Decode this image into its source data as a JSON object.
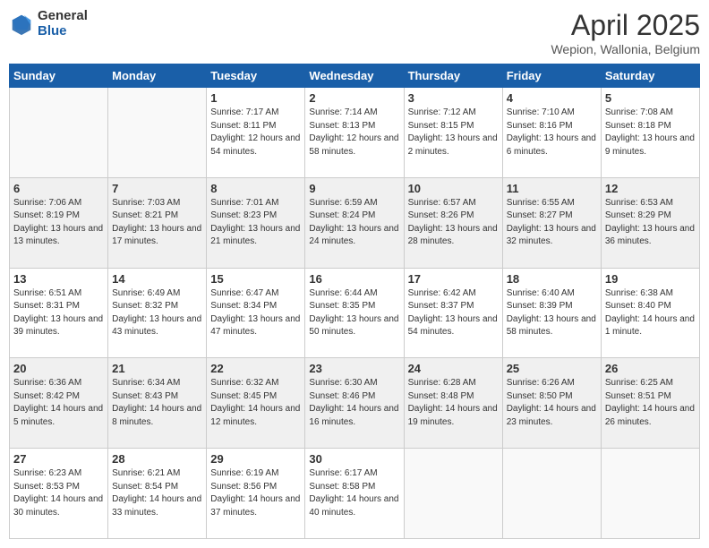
{
  "header": {
    "logo_general": "General",
    "logo_blue": "Blue",
    "month_title": "April 2025",
    "location": "Wepion, Wallonia, Belgium"
  },
  "weekdays": [
    "Sunday",
    "Monday",
    "Tuesday",
    "Wednesday",
    "Thursday",
    "Friday",
    "Saturday"
  ],
  "weeks": [
    [
      {
        "day": "",
        "sunrise": "",
        "sunset": "",
        "daylight": ""
      },
      {
        "day": "",
        "sunrise": "",
        "sunset": "",
        "daylight": ""
      },
      {
        "day": "1",
        "sunrise": "Sunrise: 7:17 AM",
        "sunset": "Sunset: 8:11 PM",
        "daylight": "Daylight: 12 hours and 54 minutes."
      },
      {
        "day": "2",
        "sunrise": "Sunrise: 7:14 AM",
        "sunset": "Sunset: 8:13 PM",
        "daylight": "Daylight: 12 hours and 58 minutes."
      },
      {
        "day": "3",
        "sunrise": "Sunrise: 7:12 AM",
        "sunset": "Sunset: 8:15 PM",
        "daylight": "Daylight: 13 hours and 2 minutes."
      },
      {
        "day": "4",
        "sunrise": "Sunrise: 7:10 AM",
        "sunset": "Sunset: 8:16 PM",
        "daylight": "Daylight: 13 hours and 6 minutes."
      },
      {
        "day": "5",
        "sunrise": "Sunrise: 7:08 AM",
        "sunset": "Sunset: 8:18 PM",
        "daylight": "Daylight: 13 hours and 9 minutes."
      }
    ],
    [
      {
        "day": "6",
        "sunrise": "Sunrise: 7:06 AM",
        "sunset": "Sunset: 8:19 PM",
        "daylight": "Daylight: 13 hours and 13 minutes."
      },
      {
        "day": "7",
        "sunrise": "Sunrise: 7:03 AM",
        "sunset": "Sunset: 8:21 PM",
        "daylight": "Daylight: 13 hours and 17 minutes."
      },
      {
        "day": "8",
        "sunrise": "Sunrise: 7:01 AM",
        "sunset": "Sunset: 8:23 PM",
        "daylight": "Daylight: 13 hours and 21 minutes."
      },
      {
        "day": "9",
        "sunrise": "Sunrise: 6:59 AM",
        "sunset": "Sunset: 8:24 PM",
        "daylight": "Daylight: 13 hours and 24 minutes."
      },
      {
        "day": "10",
        "sunrise": "Sunrise: 6:57 AM",
        "sunset": "Sunset: 8:26 PM",
        "daylight": "Daylight: 13 hours and 28 minutes."
      },
      {
        "day": "11",
        "sunrise": "Sunrise: 6:55 AM",
        "sunset": "Sunset: 8:27 PM",
        "daylight": "Daylight: 13 hours and 32 minutes."
      },
      {
        "day": "12",
        "sunrise": "Sunrise: 6:53 AM",
        "sunset": "Sunset: 8:29 PM",
        "daylight": "Daylight: 13 hours and 36 minutes."
      }
    ],
    [
      {
        "day": "13",
        "sunrise": "Sunrise: 6:51 AM",
        "sunset": "Sunset: 8:31 PM",
        "daylight": "Daylight: 13 hours and 39 minutes."
      },
      {
        "day": "14",
        "sunrise": "Sunrise: 6:49 AM",
        "sunset": "Sunset: 8:32 PM",
        "daylight": "Daylight: 13 hours and 43 minutes."
      },
      {
        "day": "15",
        "sunrise": "Sunrise: 6:47 AM",
        "sunset": "Sunset: 8:34 PM",
        "daylight": "Daylight: 13 hours and 47 minutes."
      },
      {
        "day": "16",
        "sunrise": "Sunrise: 6:44 AM",
        "sunset": "Sunset: 8:35 PM",
        "daylight": "Daylight: 13 hours and 50 minutes."
      },
      {
        "day": "17",
        "sunrise": "Sunrise: 6:42 AM",
        "sunset": "Sunset: 8:37 PM",
        "daylight": "Daylight: 13 hours and 54 minutes."
      },
      {
        "day": "18",
        "sunrise": "Sunrise: 6:40 AM",
        "sunset": "Sunset: 8:39 PM",
        "daylight": "Daylight: 13 hours and 58 minutes."
      },
      {
        "day": "19",
        "sunrise": "Sunrise: 6:38 AM",
        "sunset": "Sunset: 8:40 PM",
        "daylight": "Daylight: 14 hours and 1 minute."
      }
    ],
    [
      {
        "day": "20",
        "sunrise": "Sunrise: 6:36 AM",
        "sunset": "Sunset: 8:42 PM",
        "daylight": "Daylight: 14 hours and 5 minutes."
      },
      {
        "day": "21",
        "sunrise": "Sunrise: 6:34 AM",
        "sunset": "Sunset: 8:43 PM",
        "daylight": "Daylight: 14 hours and 8 minutes."
      },
      {
        "day": "22",
        "sunrise": "Sunrise: 6:32 AM",
        "sunset": "Sunset: 8:45 PM",
        "daylight": "Daylight: 14 hours and 12 minutes."
      },
      {
        "day": "23",
        "sunrise": "Sunrise: 6:30 AM",
        "sunset": "Sunset: 8:46 PM",
        "daylight": "Daylight: 14 hours and 16 minutes."
      },
      {
        "day": "24",
        "sunrise": "Sunrise: 6:28 AM",
        "sunset": "Sunset: 8:48 PM",
        "daylight": "Daylight: 14 hours and 19 minutes."
      },
      {
        "day": "25",
        "sunrise": "Sunrise: 6:26 AM",
        "sunset": "Sunset: 8:50 PM",
        "daylight": "Daylight: 14 hours and 23 minutes."
      },
      {
        "day": "26",
        "sunrise": "Sunrise: 6:25 AM",
        "sunset": "Sunset: 8:51 PM",
        "daylight": "Daylight: 14 hours and 26 minutes."
      }
    ],
    [
      {
        "day": "27",
        "sunrise": "Sunrise: 6:23 AM",
        "sunset": "Sunset: 8:53 PM",
        "daylight": "Daylight: 14 hours and 30 minutes."
      },
      {
        "day": "28",
        "sunrise": "Sunrise: 6:21 AM",
        "sunset": "Sunset: 8:54 PM",
        "daylight": "Daylight: 14 hours and 33 minutes."
      },
      {
        "day": "29",
        "sunrise": "Sunrise: 6:19 AM",
        "sunset": "Sunset: 8:56 PM",
        "daylight": "Daylight: 14 hours and 37 minutes."
      },
      {
        "day": "30",
        "sunrise": "Sunrise: 6:17 AM",
        "sunset": "Sunset: 8:58 PM",
        "daylight": "Daylight: 14 hours and 40 minutes."
      },
      {
        "day": "",
        "sunrise": "",
        "sunset": "",
        "daylight": ""
      },
      {
        "day": "",
        "sunrise": "",
        "sunset": "",
        "daylight": ""
      },
      {
        "day": "",
        "sunrise": "",
        "sunset": "",
        "daylight": ""
      }
    ]
  ]
}
